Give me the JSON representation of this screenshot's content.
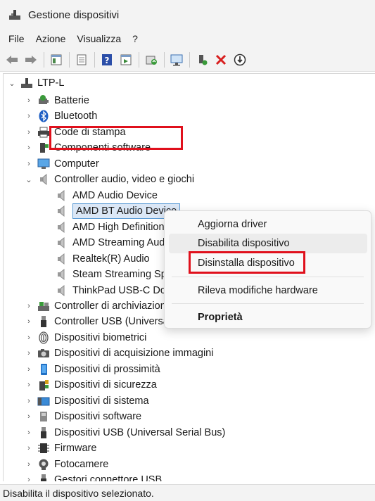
{
  "window": {
    "title": "Gestione dispositivi"
  },
  "menubar": {
    "items": [
      "File",
      "Azione",
      "Visualizza",
      "?"
    ]
  },
  "toolbar": {
    "buttons": [
      "back-arrow-icon",
      "forward-arrow-icon",
      "properties-icon",
      "device-list-icon",
      "help-icon",
      "run-icon",
      "update-driver-icon",
      "scan-hardware-icon",
      "enable-device-icon",
      "uninstall-icon",
      "download-icon"
    ]
  },
  "tree": {
    "root": "LTP-L",
    "categories": [
      {
        "label": "Batterie",
        "icon": "battery-icon"
      },
      {
        "label": "Bluetooth",
        "icon": "bluetooth-icon"
      },
      {
        "label": "Code di stampa",
        "icon": "printer-icon"
      },
      {
        "label": "Componenti software",
        "icon": "software-component-icon"
      },
      {
        "label": "Computer",
        "icon": "computer-icon"
      },
      {
        "label": "Controller audio, video e giochi",
        "icon": "speaker-icon",
        "expanded": true
      },
      {
        "label": "Controller di archiviazione",
        "icon": "storage-controller-icon"
      },
      {
        "label": "Controller USB (Universal Serial Bus)",
        "icon": "usb-icon"
      },
      {
        "label": "Dispositivi biometrici",
        "icon": "fingerprint-icon"
      },
      {
        "label": "Dispositivi di acquisizione immagini",
        "icon": "camera-icon"
      },
      {
        "label": "Dispositivi di prossimità",
        "icon": "proximity-icon"
      },
      {
        "label": "Dispositivi di sicurezza",
        "icon": "security-device-icon"
      },
      {
        "label": "Dispositivi di sistema",
        "icon": "system-device-icon"
      },
      {
        "label": "Dispositivi software",
        "icon": "software-device-icon"
      },
      {
        "label": "Dispositivi USB (Universal Serial Bus)",
        "icon": "usb-icon"
      },
      {
        "label": "Firmware",
        "icon": "firmware-icon"
      },
      {
        "label": "Fotocamere",
        "icon": "webcam-icon"
      },
      {
        "label": "Gestori connettore USB",
        "icon": "usb-connector-icon"
      }
    ],
    "audio_children": [
      "AMD Audio Device",
      "AMD BT Audio Device",
      "AMD High Definition Audio Device",
      "AMD Streaming Audio Device",
      "Realtek(R) Audio",
      "Steam Streaming Speakers",
      "ThinkPad USB-C Dock Audio"
    ],
    "selected": "AMD BT Audio Device"
  },
  "context_menu": {
    "items": [
      "Aggiorna driver",
      "Disabilita dispositivo",
      "Disinstalla dispositivo",
      "Rileva modifiche hardware",
      "Proprietà"
    ],
    "hovered": "Disabilita dispositivo",
    "highlighted": "Disinstalla dispositivo"
  },
  "status": {
    "text": "Disabilita il dispositivo selezionato."
  },
  "colors": {
    "highlight_box": "#e0101c",
    "selection": "#dbe7f6"
  }
}
